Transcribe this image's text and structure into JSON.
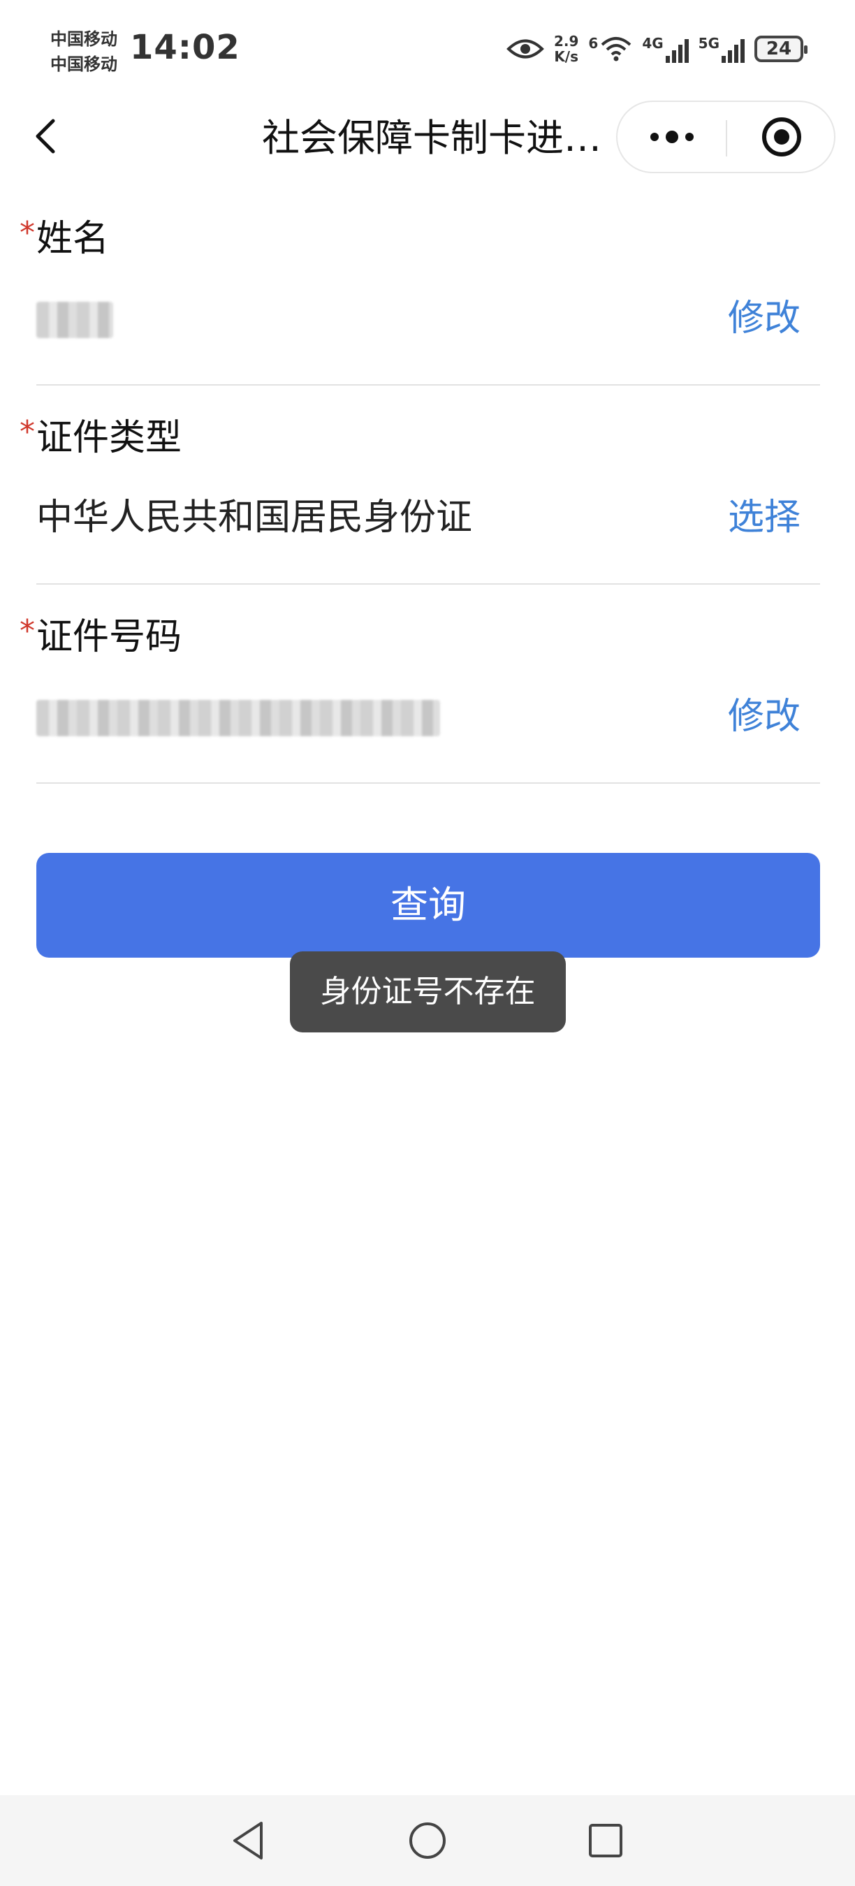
{
  "status_bar": {
    "carrier1": "中国移动",
    "carrier2": "中国移动",
    "time": "14:02",
    "net_speed_value": "2.9",
    "net_speed_unit": "K/s",
    "wifi_label": "6",
    "sig1_label": "4G",
    "sig2_label": "5G",
    "battery": "24",
    "icons": [
      "eye-icon",
      "wifi-icon",
      "signal-icon",
      "signal-icon",
      "battery-icon"
    ]
  },
  "nav": {
    "title": "社会保障卡制卡进…",
    "icons": [
      "back-arrow-icon",
      "more-dots-icon",
      "target-circle-icon"
    ]
  },
  "form": {
    "name": {
      "label": "姓名",
      "required_mark": "*",
      "action": "修改"
    },
    "id_type": {
      "label": "证件类型",
      "required_mark": "*",
      "value": "中华人民共和国居民身份证",
      "action": "选择"
    },
    "id_number": {
      "label": "证件号码",
      "required_mark": "*",
      "action": "修改"
    }
  },
  "query_button": "查询",
  "toast": "身份证号不存在",
  "colors": {
    "accent_blue": "#3f82d8",
    "button_blue": "#4674e5",
    "required_red": "#d0382c",
    "toast_bg": "#4a4a4a"
  },
  "system_nav": {
    "icons": [
      "back-triangle-icon",
      "home-circle-icon",
      "recents-square-icon"
    ]
  }
}
